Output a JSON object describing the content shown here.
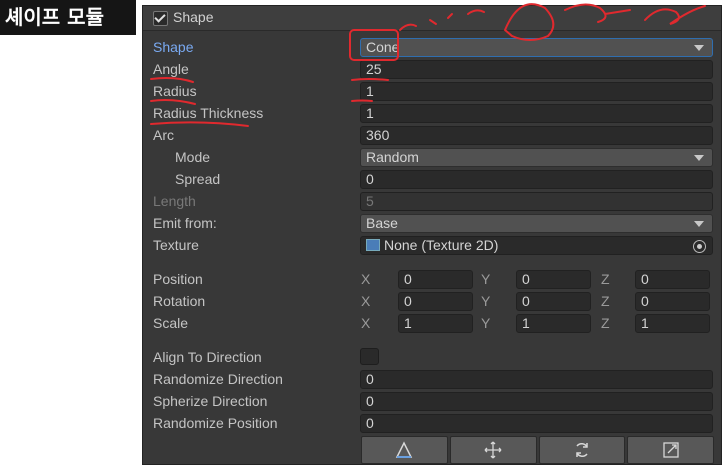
{
  "title_tag": "셰이프 모듈",
  "header": {
    "title": "Shape"
  },
  "rows": {
    "shape": {
      "label": "Shape",
      "value": "Cone"
    },
    "angle": {
      "label": "Angle",
      "value": "25"
    },
    "radius": {
      "label": "Radius",
      "value": "1"
    },
    "radius_thickness": {
      "label": "Radius Thickness",
      "value": "1"
    },
    "arc": {
      "label": "Arc",
      "value": "360"
    },
    "mode": {
      "label": "Mode",
      "value": "Random"
    },
    "spread": {
      "label": "Spread",
      "value": "0"
    },
    "length": {
      "label": "Length",
      "value": "5"
    },
    "emit_from": {
      "label": "Emit from:",
      "value": "Base"
    },
    "texture": {
      "label": "Texture",
      "value": "None (Texture 2D)"
    }
  },
  "vectors": {
    "position": {
      "label": "Position",
      "x": "0",
      "y": "0",
      "z": "0"
    },
    "rotation": {
      "label": "Rotation",
      "x": "0",
      "y": "0",
      "z": "0"
    },
    "scale": {
      "label": "Scale",
      "x": "1",
      "y": "1",
      "z": "1"
    },
    "axis_x": "X",
    "axis_y": "Y",
    "axis_z": "Z"
  },
  "flags": {
    "align_to_direction": {
      "label": "Align To Direction",
      "checked": false
    },
    "randomize_direction": {
      "label": "Randomize Direction",
      "value": "0"
    },
    "spherize_direction": {
      "label": "Spherize Direction",
      "value": "0"
    },
    "randomize_position": {
      "label": "Randomize Position",
      "value": "0"
    }
  },
  "toolbar": {
    "icons": [
      "edit-shape-icon",
      "move-icon",
      "rotate-icon",
      "scale-icon"
    ]
  },
  "colors": {
    "panel": "#383838",
    "field": "#2a2a2a",
    "annotation": "#e0292e",
    "highlight_label": "#7aaaf2"
  }
}
